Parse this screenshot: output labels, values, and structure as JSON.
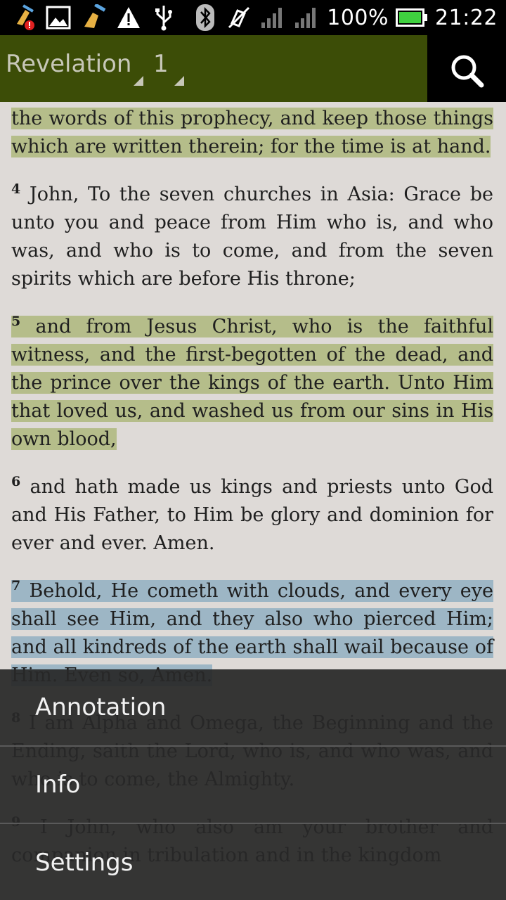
{
  "status_bar": {
    "battery": "100%",
    "time": "21:22",
    "icons": [
      "cleaner-alert-icon",
      "image-icon",
      "cleaner-icon",
      "warning-icon",
      "usb-icon",
      "bluetooth-icon",
      "vibrate-off-icon",
      "signal-icon",
      "signal-icon",
      "battery-icon"
    ]
  },
  "toolbar": {
    "book": "Revelation",
    "chapter": "1",
    "search_icon": "search-icon"
  },
  "verses": [
    {
      "num": "",
      "text": "the words of this prophecy, and keep those things which are written therein; for the time is at hand.",
      "highlight": "green"
    },
    {
      "num": "4",
      "text": "John, To the seven churches in Asia: Grace be unto you and peace from Him who is, and who was, and who is to come, and from the seven spirits which are before His throne;",
      "highlight": "none"
    },
    {
      "num": "5",
      "text": "and from Jesus Christ, who is the faithful witness, and the first-begotten of the dead, and the prince over the kings of the earth. Unto Him that loved us, and washed us from our sins in His own blood,",
      "highlight": "green"
    },
    {
      "num": "6",
      "text": "and hath made us kings and priests unto God and His Father, to Him be glory and dominion for ever and ever. Amen.",
      "highlight": "none"
    },
    {
      "num": "7",
      "text": "Behold, He cometh with clouds, and every eye shall see Him, and they also who pierced Him; and all kindreds of the earth shall wail because of Him. Even so, Amen.",
      "highlight": "blue"
    },
    {
      "num": "8",
      "text": "I am Alpha and Omega, the Beginning and the Ending, saith the Lord, who is, and who was, and who is to come, the Almighty.",
      "highlight": "none"
    },
    {
      "num": "9",
      "text": "I John, who also am your brother and companion in tribulation and in the kingdom",
      "highlight": "none"
    }
  ],
  "menu": {
    "items": [
      "Annotation",
      "Info",
      "Settings"
    ]
  },
  "colors": {
    "toolbar": "#3c4d07",
    "page": "#dedad7",
    "highlight_green": "#b5bd8a",
    "highlight_blue": "#9db6c5"
  }
}
